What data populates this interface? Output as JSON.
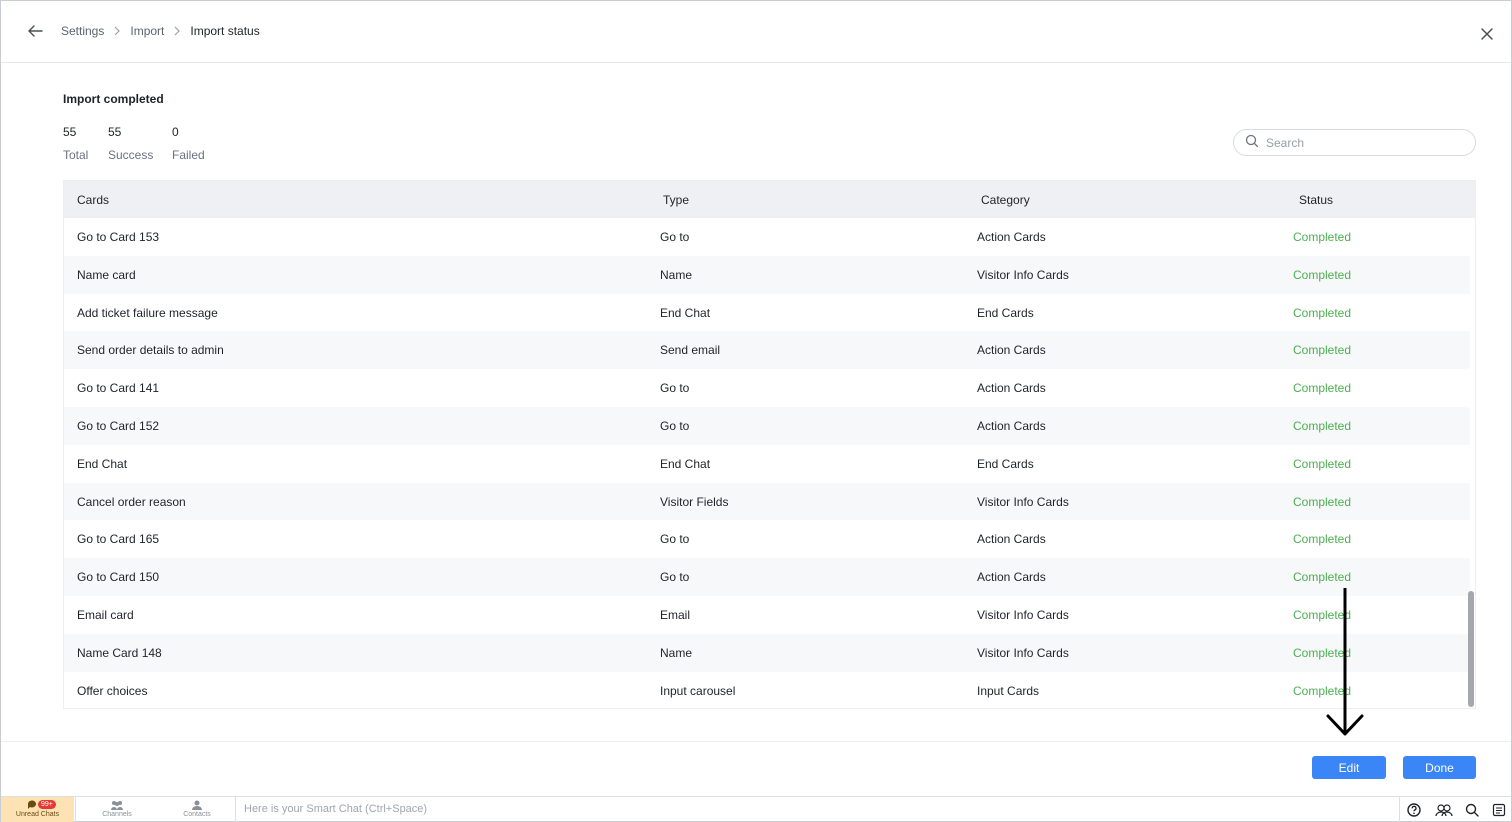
{
  "header": {
    "breadcrumb": [
      "Settings",
      "Import",
      "Import status"
    ]
  },
  "summary": {
    "title": "Import completed",
    "stats": [
      {
        "value": "55",
        "label": "Total"
      },
      {
        "value": "55",
        "label": "Success"
      },
      {
        "value": "0",
        "label": "Failed"
      }
    ]
  },
  "search": {
    "placeholder": "Search"
  },
  "table": {
    "columns": [
      "Cards",
      "Type",
      "Category",
      "Status"
    ],
    "rows": [
      [
        "Go to Card 153",
        "Go to",
        "Action Cards",
        "Completed"
      ],
      [
        "Name card",
        "Name",
        "Visitor Info Cards",
        "Completed"
      ],
      [
        "Add ticket failure message",
        "End Chat",
        "End Cards",
        "Completed"
      ],
      [
        "Send order details to admin",
        "Send email",
        "Action Cards",
        "Completed"
      ],
      [
        "Go to Card 141",
        "Go to",
        "Action Cards",
        "Completed"
      ],
      [
        "Go to Card 152",
        "Go to",
        "Action Cards",
        "Completed"
      ],
      [
        "End Chat",
        "End Chat",
        "End Cards",
        "Completed"
      ],
      [
        "Cancel order reason",
        "Visitor Fields",
        "Visitor Info Cards",
        "Completed"
      ],
      [
        "Go to Card 165",
        "Go to",
        "Action Cards",
        "Completed"
      ],
      [
        "Go to Card 150",
        "Go to",
        "Action Cards",
        "Completed"
      ],
      [
        "Email card",
        "Email",
        "Visitor Info Cards",
        "Completed"
      ],
      [
        "Name Card 148",
        "Name",
        "Visitor Info Cards",
        "Completed"
      ],
      [
        "Offer choices",
        "Input carousel",
        "Input Cards",
        "Completed"
      ]
    ]
  },
  "actions": {
    "edit_label": "Edit",
    "done_label": "Done"
  },
  "taskbar": {
    "unread_badge": "99+",
    "unread_label": "Unread Chats",
    "channels_label": "Channels",
    "contacts_label": "Contacts",
    "smartchat_placeholder": "Here is your Smart Chat (Ctrl+Space)"
  },
  "colors": {
    "primary": "#3a86f7",
    "status_completed": "#4caf50",
    "table_header_bg": "#eef0f4",
    "unread_bg": "#fde3b4"
  },
  "icons": [
    "back-arrow-icon",
    "chevron-right-icon",
    "close-icon",
    "search-icon",
    "help-icon",
    "people-icon",
    "search-icon",
    "notes-icon"
  ]
}
